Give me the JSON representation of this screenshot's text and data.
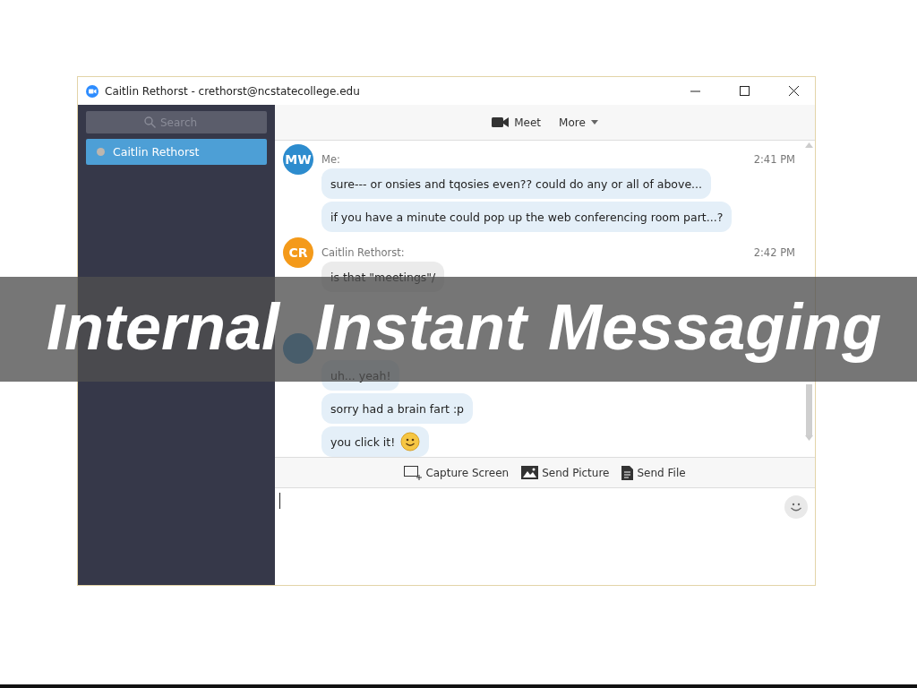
{
  "window": {
    "title": "Caitlin Rethorst - crethorst@ncstatecollege.edu"
  },
  "sidebar": {
    "search": {
      "placeholder": "Search"
    },
    "contacts": [
      {
        "name": "Caitlin Rethorst",
        "selected": true
      }
    ]
  },
  "chat_header": {
    "actions": [
      {
        "kind": "video",
        "label": "Meet"
      },
      {
        "kind": "dropdown",
        "label": "More"
      }
    ]
  },
  "messages": [
    {
      "initials": "MW",
      "color": "#2d8cce",
      "sender": "Me:",
      "time": "2:41 PM",
      "bubbles": [
        {
          "kind": "me",
          "text": "sure--- or onsies and tqosies even?? could do any or all of above...",
          "emoji": false
        },
        {
          "kind": "me",
          "text": "if you have a minute could pop up the web conferencing room part...?",
          "emoji": false
        }
      ]
    },
    {
      "initials": "CR",
      "color": "#f49a1a",
      "sender": "Caitlin Rethorst:",
      "time": "2:42 PM",
      "bubbles": [
        {
          "kind": "other",
          "text": "is that \"meetings\"/",
          "emoji": false
        }
      ]
    },
    {
      "bubbles": [
        {
          "kind": "me",
          "text": "uh... yeah!",
          "emoji": false
        },
        {
          "kind": "me",
          "text": "sorry had a brain fart :p",
          "emoji": false
        },
        {
          "kind": "me",
          "text": "you click it!",
          "emoji": true
        }
      ]
    }
  ],
  "toolbar": [
    {
      "kind": "capture",
      "label": "Capture Screen"
    },
    {
      "kind": "picture",
      "label": "Send Picture"
    },
    {
      "kind": "file",
      "label": "Send File"
    }
  ],
  "banner": {
    "title": "Internal Instant Messaging"
  }
}
